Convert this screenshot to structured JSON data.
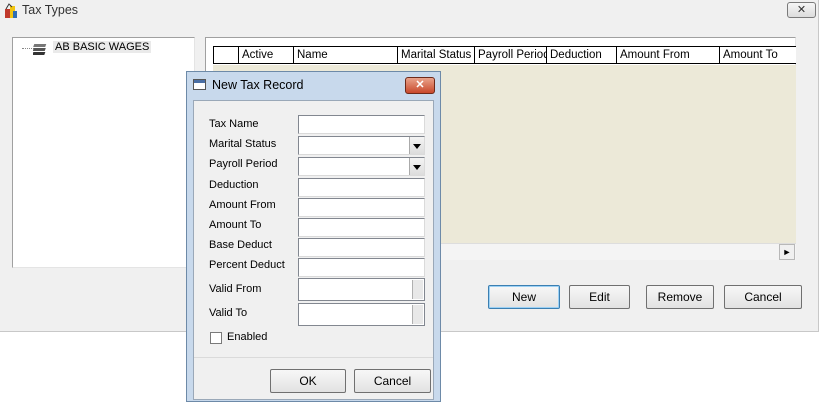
{
  "window": {
    "title": "Tax Types",
    "close_glyph": "✕"
  },
  "tree": {
    "items": [
      {
        "label": "AB BASIC WAGES",
        "icon": "tree-node-icon"
      }
    ]
  },
  "grid": {
    "columns": [
      "",
      "Active",
      "Name",
      "Marital Status",
      "Payroll Period",
      "Deduction",
      "Amount From",
      "Amount To"
    ],
    "body_color": "#ece9d8",
    "scroll_arrow": "►"
  },
  "buttons": {
    "new": "New",
    "edit": "Edit",
    "remove": "Remove",
    "cancel": "Cancel"
  },
  "dialog": {
    "title": "New Tax Record",
    "close_glyph": "✕",
    "fields": {
      "tax_name": {
        "label": "Tax Name",
        "value": ""
      },
      "marital_status": {
        "label": "Marital Status",
        "value": ""
      },
      "payroll_period": {
        "label": "Payroll Period",
        "value": ""
      },
      "deduction": {
        "label": "Deduction",
        "value": ""
      },
      "amount_from": {
        "label": "Amount From",
        "value": ""
      },
      "amount_to": {
        "label": "Amount To",
        "value": ""
      },
      "base_deduct": {
        "label": "Base Deduct",
        "value": ""
      },
      "percent_deduct": {
        "label": "Percent Deduct",
        "value": ""
      },
      "valid_from": {
        "label": "Valid From",
        "value": ""
      },
      "valid_to": {
        "label": "Valid To",
        "value": ""
      }
    },
    "enabled": {
      "label": "Enabled",
      "checked": false
    },
    "ok_label": "OK",
    "cancel_label": "Cancel"
  },
  "colors": {
    "accent": "#3c7fb1",
    "dialog_frame": "#c8d9ec",
    "close_red": "#c9482b"
  }
}
